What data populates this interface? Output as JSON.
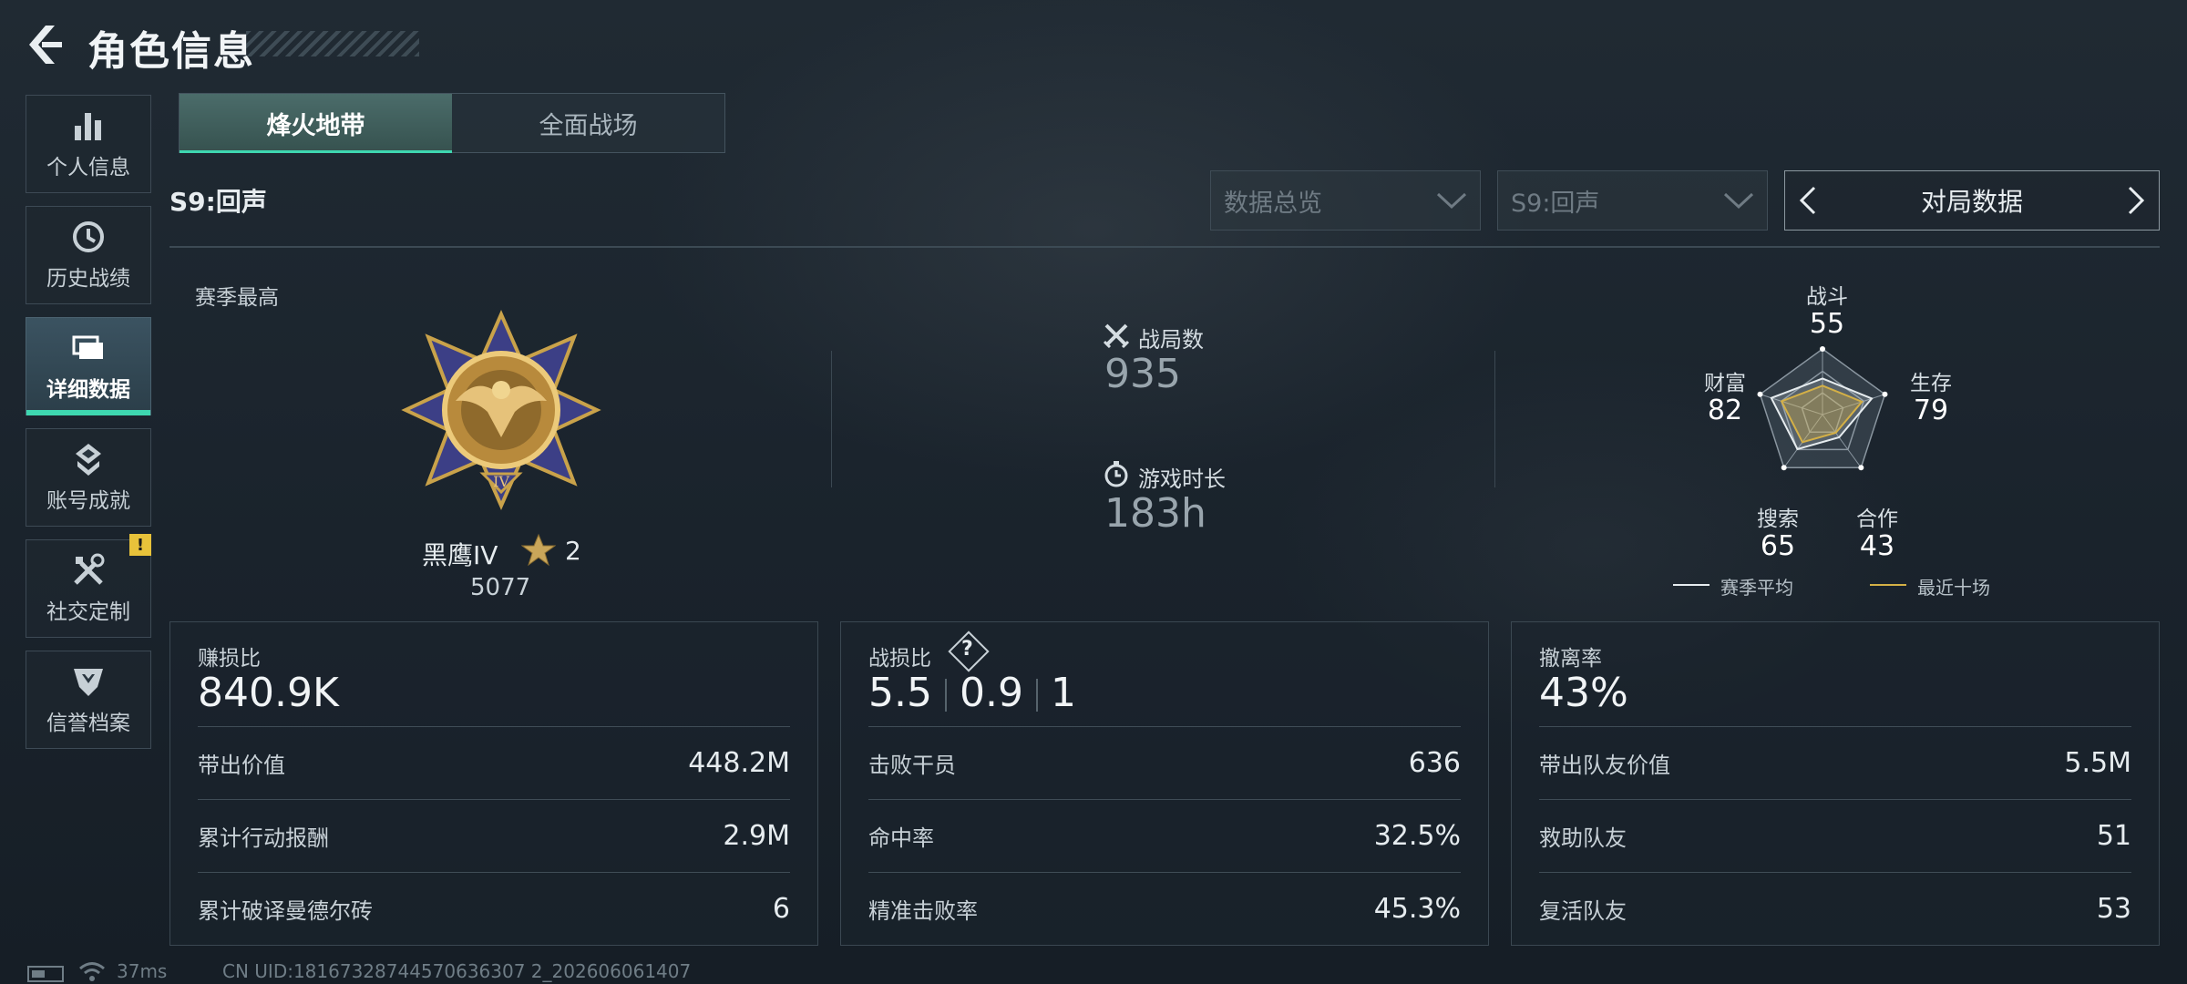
{
  "header": {
    "title": "角色信息"
  },
  "sidebar": {
    "items": [
      {
        "label": "个人信息",
        "icon": "bar-chart-icon"
      },
      {
        "label": "历史战绩",
        "icon": "history-icon"
      },
      {
        "label": "详细数据",
        "icon": "stacked-cards-icon",
        "active": true
      },
      {
        "label": "账号成就",
        "icon": "achievement-icon"
      },
      {
        "label": "社交定制",
        "icon": "tools-icon",
        "badge": "!"
      },
      {
        "label": "信誉档案",
        "icon": "credit-shield-icon"
      }
    ]
  },
  "mode_tabs": [
    {
      "label": "烽火地带",
      "active": true
    },
    {
      "label": "全面战场",
      "active": false
    }
  ],
  "season": {
    "label": "S9:回声"
  },
  "filters": {
    "dropdown1": "数据总览",
    "dropdown2": "S9:回声",
    "pager_label": "对局数据"
  },
  "season_best": {
    "label": "赛季最高",
    "rank_name": "黑鹰IV",
    "stars": "2",
    "score": "5077"
  },
  "stats": {
    "matches_label": "战局数",
    "matches_value": "935",
    "playtime_label": "游戏时长",
    "playtime_value": "183h"
  },
  "radar": {
    "axes": [
      {
        "label": "战斗",
        "value": "55"
      },
      {
        "label": "生存",
        "value": "79"
      },
      {
        "label": "合作",
        "value": "43"
      },
      {
        "label": "搜索",
        "value": "65"
      },
      {
        "label": "财富",
        "value": "82"
      }
    ],
    "legend_season": "赛季平均",
    "legend_recent": "最近十场",
    "colors": {
      "season": "#e6ecef",
      "recent": "#d4b046"
    }
  },
  "panels": {
    "profit": {
      "title": "赚损比",
      "big": "840.9K",
      "rows": [
        {
          "k": "带出价值",
          "v": "448.2M"
        },
        {
          "k": "累计行动报酬",
          "v": "2.9M"
        },
        {
          "k": "累计破译曼德尔砖",
          "v": "6"
        }
      ]
    },
    "combat": {
      "title": "战损比",
      "help": "?",
      "big_a": "5.5",
      "big_b": "0.9",
      "big_c": "1",
      "rows": [
        {
          "k": "击败干员",
          "v": "636"
        },
        {
          "k": "命中率",
          "v": "32.5%"
        },
        {
          "k": "精准击败率",
          "v": "45.3%"
        }
      ]
    },
    "extract": {
      "title": "撤离率",
      "big": "43%",
      "rows": [
        {
          "k": "带出队友价值",
          "v": "5.5M"
        },
        {
          "k": "救助队友",
          "v": "51"
        },
        {
          "k": "复活队友",
          "v": "53"
        }
      ]
    }
  },
  "footer": {
    "ping": "37ms",
    "uid": "CN UID:18167328744570636307 2_202606061407"
  },
  "accent": "#3ed7b0"
}
